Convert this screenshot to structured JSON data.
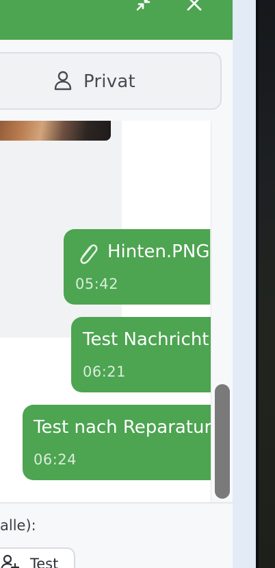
{
  "header": {
    "minimize_icon": "collapse-arrows-icon",
    "close_icon": "close-icon"
  },
  "mode": {
    "label": "Privat",
    "icon": "user-icon"
  },
  "messages": [
    {
      "type": "outgoing",
      "text": "Hinten.PNG",
      "time": "05:42",
      "attachment_icon": "paperclip-icon"
    },
    {
      "type": "outgoing",
      "text": "Test Nachricht",
      "time": "06:21"
    },
    {
      "type": "outgoing",
      "text": "Test nach Reparatur",
      "time": "06:24"
    }
  ],
  "footer": {
    "label": "alle):",
    "chip": {
      "label": "Test",
      "icon": "add-user-icon"
    }
  },
  "colors": {
    "header": "#4da451",
    "bubble": "#4da451",
    "panel_bg": "#f7f8fa",
    "scroll_thumb": "#7a7a7a"
  }
}
